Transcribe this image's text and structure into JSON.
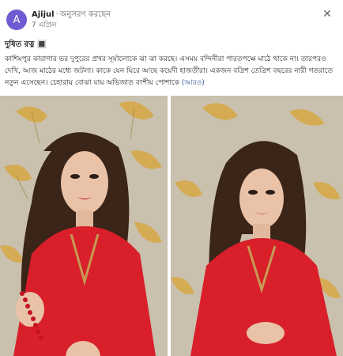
{
  "post": {
    "author": "Ajijul",
    "follow_text": "অনুসরণ করছেন",
    "date": "7 এপ্রিল",
    "avatar_letter": "A",
    "avatar_color": "#6f5bd2",
    "title": "দুষিত রত্ন 🔳",
    "body": "কাশিমপুর কারাগার ভর দুপুরের প্রখর সূর্যালোকে ঝা ঝা করছে। এসময় বন্দিনীরা পারতপক্ষে মাঠে থাকে না। তারপরও দেখি, আজ মাঠের মধ্যে জটলা। কাকে যেন ঘিরে আছে কয়েদী হাজতীরা। একজন বত্রিশ তেত্রিশ বছরের নারী গতরাতে নতুন এসেছেন। চেহারায় বোঝা যায় অভিজাত বংশীয় পোশাকে ",
    "see_more": "(আরও)"
  },
  "icons": {
    "close": "close-icon"
  },
  "colors": {
    "dress_red": "#d81f2a",
    "wallpaper_gold": "#d6a94a",
    "wallpaper_base": "#c9c0ad"
  }
}
